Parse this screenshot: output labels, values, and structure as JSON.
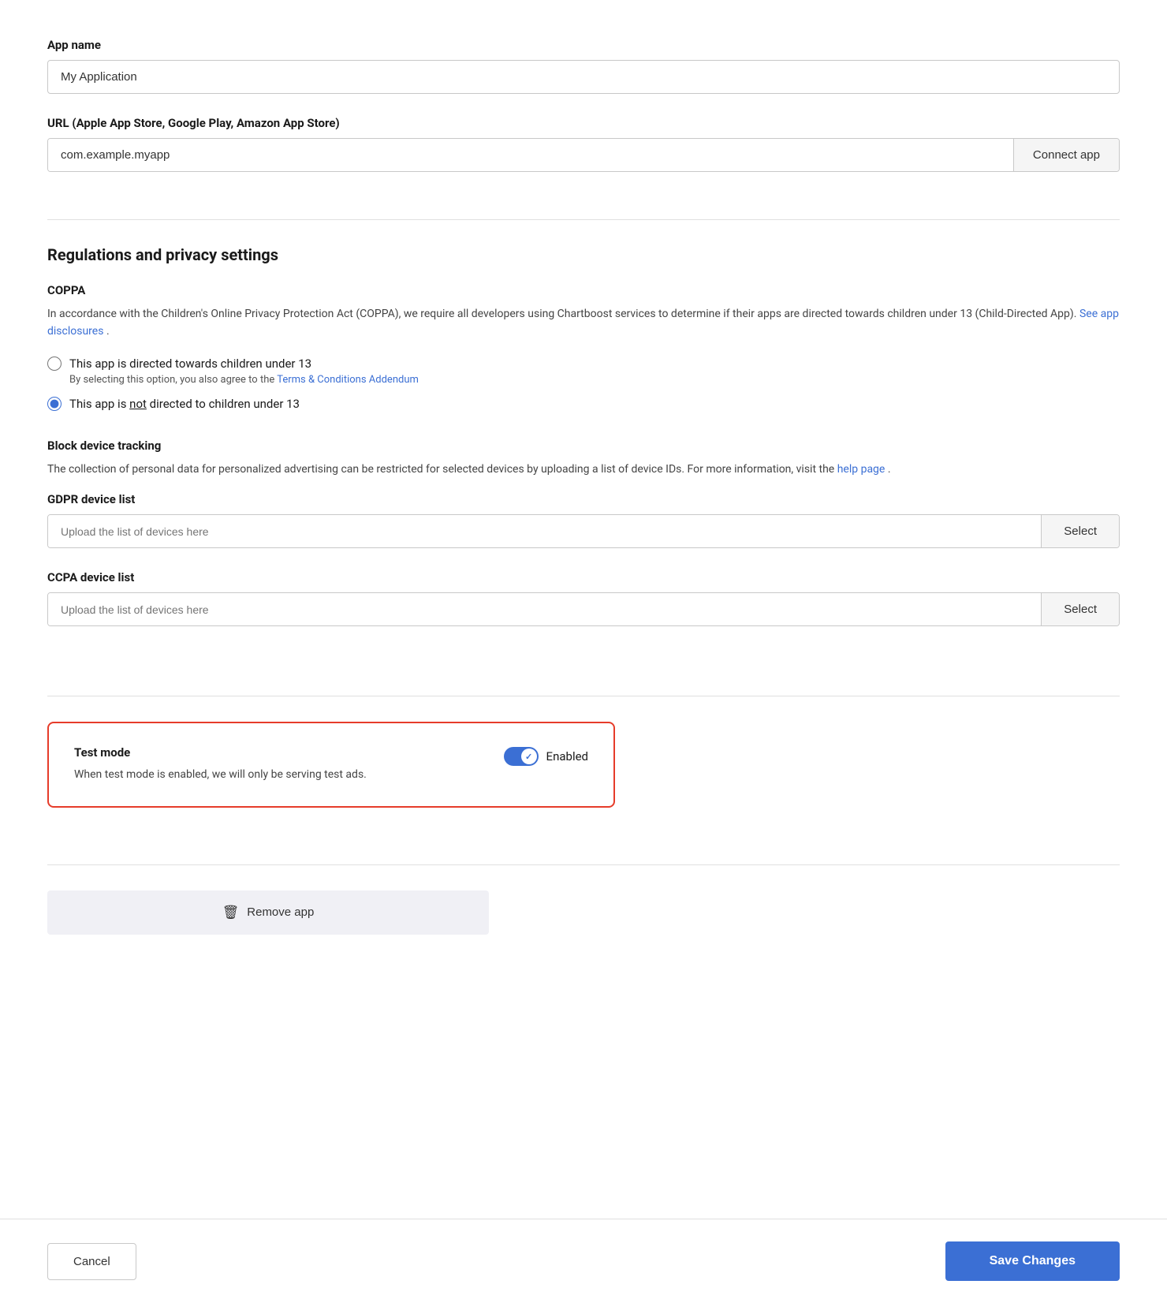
{
  "app_name": {
    "label": "App name",
    "value": "My Application",
    "placeholder": "My Application"
  },
  "app_url": {
    "label": "URL (Apple App Store, Google Play, Amazon App Store)",
    "value": "com.example.myapp",
    "placeholder": "com.example.myapp",
    "connect_btn": "Connect app"
  },
  "regulations": {
    "section_title": "Regulations and privacy settings",
    "coppa": {
      "title": "COPPA",
      "description_part1": "In accordance with the Children's Online Privacy Protection Act (COPPA), we require all developers using Chartboost services to determine if their apps are directed towards children under 13 (Child-Directed App). ",
      "see_disclosures_link": "See app disclosures",
      "description_end": ".",
      "option1": {
        "label": "This app is directed towards children under 13",
        "sublabel_part1": "By selecting this option, you also agree to the ",
        "sublabel_link": "Terms & Conditions Addendum",
        "value": "directed"
      },
      "option2": {
        "label_prefix": "This app is ",
        "label_underline": "not",
        "label_suffix": " directed to children under 13",
        "value": "not_directed"
      }
    },
    "block_tracking": {
      "title": "Block device tracking",
      "description_part1": "The collection of personal data for personalized advertising can be restricted for selected devices by uploading a list of device IDs. For more information, visit the ",
      "help_link": "help page",
      "description_end": "."
    },
    "gdpr": {
      "label": "GDPR device list",
      "placeholder": "Upload the list of devices here",
      "select_btn": "Select"
    },
    "ccpa": {
      "label": "CCPA device list",
      "placeholder": "Upload the list of devices here",
      "select_btn": "Select"
    }
  },
  "test_mode": {
    "title": "Test mode",
    "description": "When test mode is enabled, we will only be serving test ads.",
    "toggle_label": "Enabled",
    "enabled": true
  },
  "remove_app": {
    "label": "Remove app"
  },
  "footer": {
    "cancel_label": "Cancel",
    "save_label": "Save Changes"
  }
}
